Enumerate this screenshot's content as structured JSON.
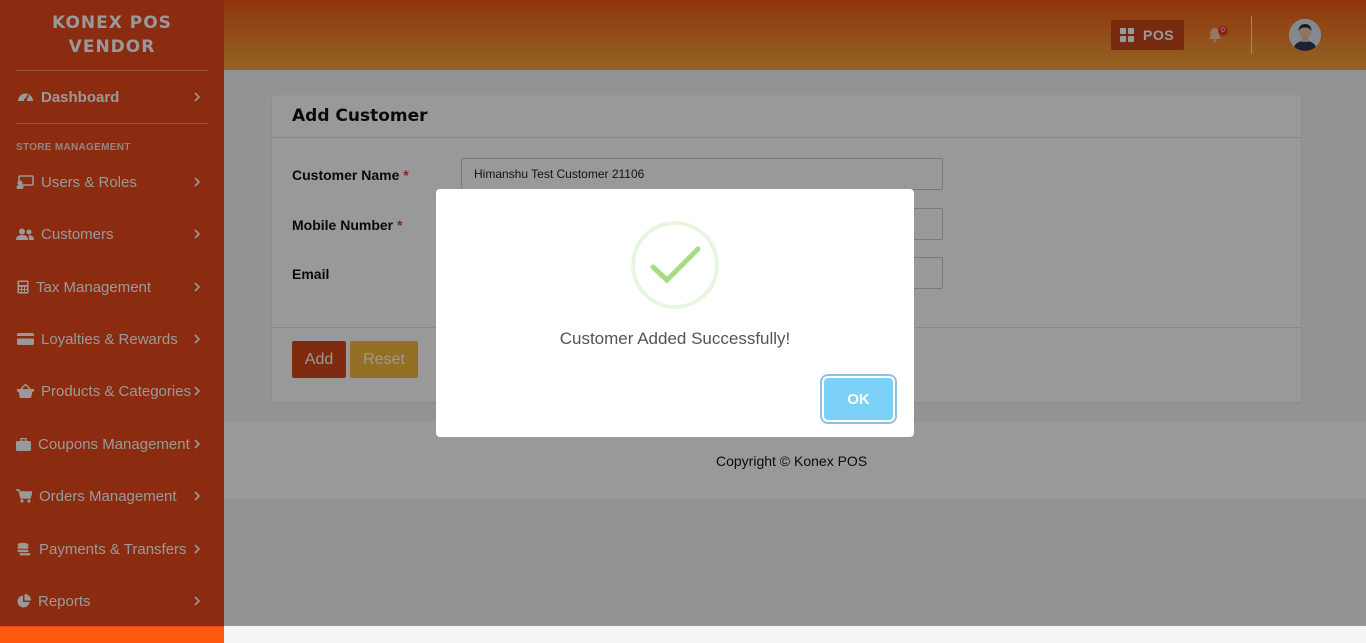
{
  "sidebar": {
    "brand": "KONEX POS VENDOR",
    "section_label": "STORE MANAGEMENT",
    "items": [
      {
        "label": "Dashboard",
        "icon": "dashboard-gauge-icon"
      },
      {
        "label": "Users & Roles",
        "icon": "users-roles-icon"
      },
      {
        "label": "Customers",
        "icon": "customers-icon"
      },
      {
        "label": "Tax Management",
        "icon": "calculator-icon"
      },
      {
        "label": "Loyalties & Rewards",
        "icon": "credit-card-icon"
      },
      {
        "label": "Products & Categories",
        "icon": "basket-icon"
      },
      {
        "label": "Coupons Management",
        "icon": "briefcase-icon"
      },
      {
        "label": "Orders Management",
        "icon": "cart-icon"
      },
      {
        "label": "Payments & Transfers",
        "icon": "coins-icon"
      },
      {
        "label": "Reports",
        "icon": "pie-chart-icon"
      }
    ]
  },
  "header": {
    "pos_label": "POS",
    "notification_count": "0"
  },
  "form": {
    "title": "Add Customer",
    "fields": [
      {
        "label": "Customer Name",
        "required": "*",
        "value": "Himanshu Test Customer 21106"
      },
      {
        "label": "Mobile Number",
        "required": "*",
        "value": ""
      },
      {
        "label": "Email",
        "value": ""
      }
    ],
    "add_label": "Add",
    "reset_label": "Reset"
  },
  "footer": {
    "copyright": "Copyright © Konex POS"
  },
  "modal": {
    "message": "Customer Added Successfully!",
    "ok_label": "OK"
  },
  "colors": {
    "sidebar": "#e8491a",
    "accent": "#c8471b",
    "ok_button": "#7cd1f9",
    "success_check": "#a5dc86"
  }
}
